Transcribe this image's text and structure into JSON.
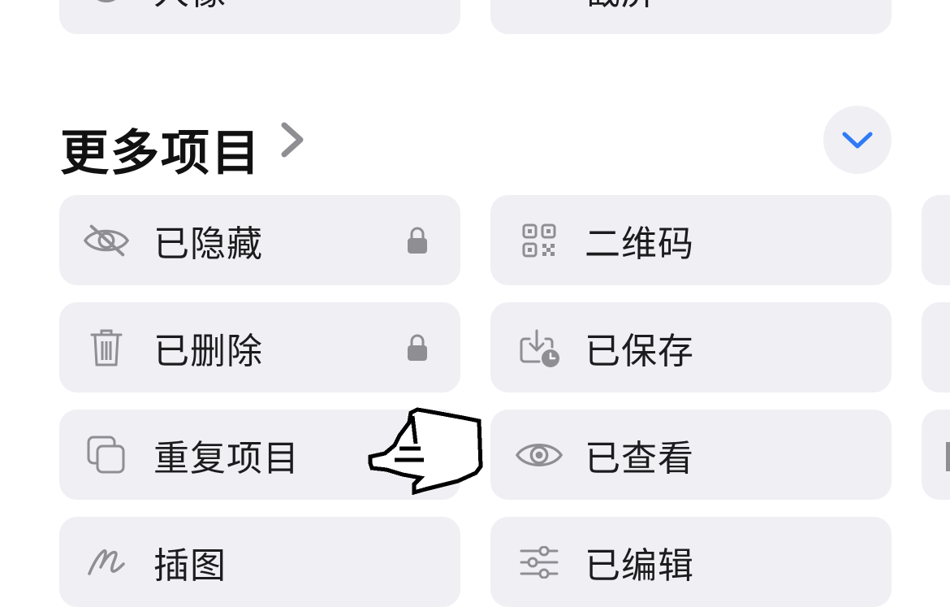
{
  "top_row": {
    "left_label": "人像",
    "right_label": "截屏"
  },
  "section": {
    "title": "更多项目"
  },
  "items_left": [
    {
      "label": "已隐藏",
      "icon": "eye-slash-icon",
      "locked": true
    },
    {
      "label": "已删除",
      "icon": "trash-icon",
      "locked": true
    },
    {
      "label": "重复项目",
      "icon": "duplicate-icon",
      "locked": false
    },
    {
      "label": "插图",
      "icon": "scribble-icon",
      "locked": false
    }
  ],
  "items_right": [
    {
      "label": "二维码",
      "icon": "qr-code-icon"
    },
    {
      "label": "已保存",
      "icon": "saved-download-icon"
    },
    {
      "label": "已查看",
      "icon": "eye-icon"
    },
    {
      "label": "已编辑",
      "icon": "sliders-icon"
    }
  ],
  "colors": {
    "tile_bg": "#efeff4",
    "accent": "#2f7bf5",
    "icon_gray": "#8e8e93"
  }
}
